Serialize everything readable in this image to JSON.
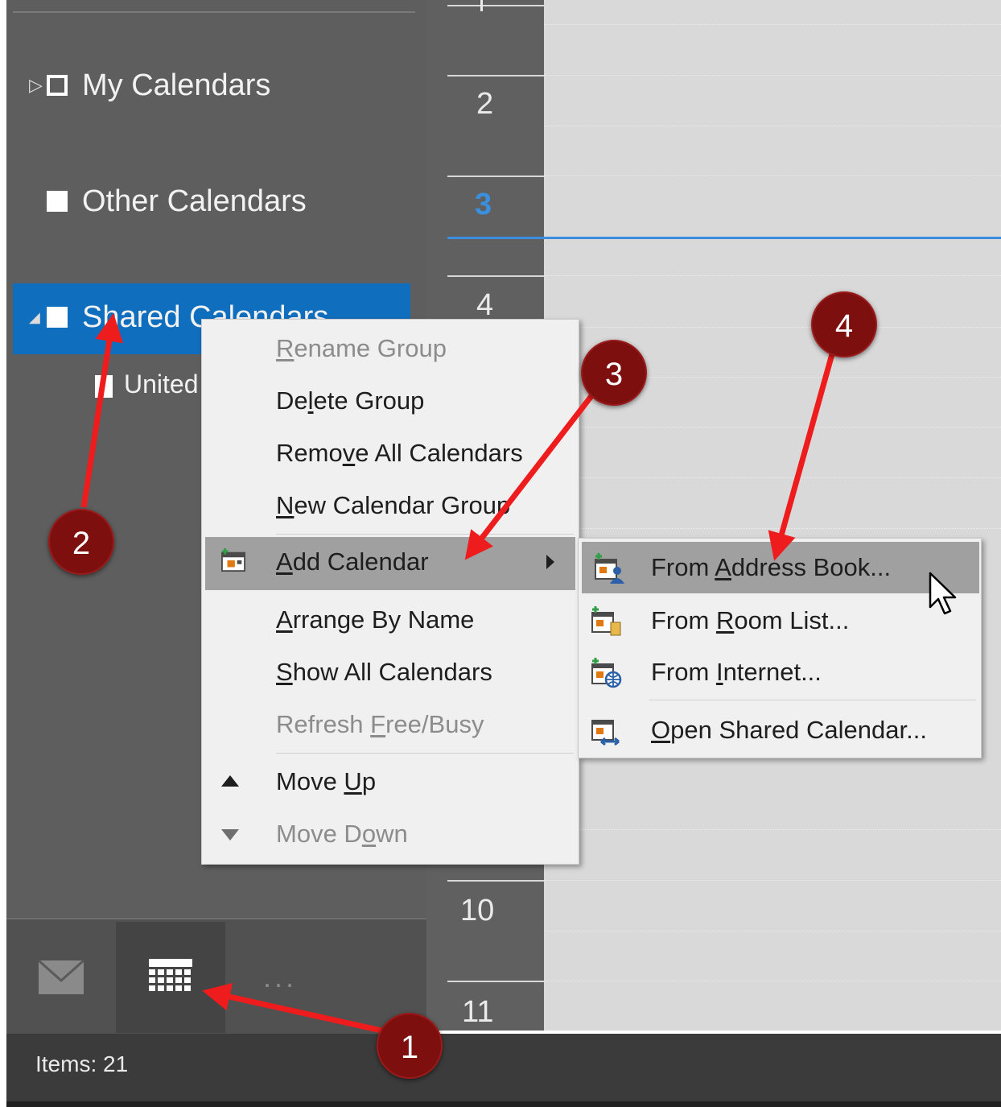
{
  "sidebar": {
    "groups": [
      {
        "label": "My Calendars"
      },
      {
        "label": "Other Calendars"
      },
      {
        "label": "Shared Calendars"
      }
    ],
    "sub_item": "United"
  },
  "time_labels": [
    "2",
    "3",
    "4",
    "10",
    "11"
  ],
  "current_hour": "3",
  "colors": {
    "accent": "#0f6ebd",
    "now_line": "#3a8fde",
    "callout": "#7d0f0f",
    "arrow": "#ee1c1c"
  },
  "context_menu": {
    "items": [
      {
        "label_pre": "",
        "key": "R",
        "label_post": "ename Group",
        "disabled": true
      },
      {
        "label_pre": "De",
        "key": "l",
        "label_post": "ete Group",
        "disabled": false
      },
      {
        "label_pre": "Remo",
        "key": "v",
        "label_post": "e All Calendars",
        "disabled": false
      },
      {
        "label_pre": "",
        "key": "N",
        "label_post": "ew Calendar Group",
        "disabled": false
      },
      {
        "label_pre": "",
        "key": "A",
        "label_post": "dd Calendar",
        "disabled": false,
        "highlighted": true,
        "icon": "add-calendar-icon",
        "has_submenu": true
      },
      {
        "label_pre": "",
        "key": "A",
        "label_post": "rrange By Name",
        "disabled": false
      },
      {
        "label_pre": "",
        "key": "S",
        "label_post": "how All Calendars",
        "disabled": false
      },
      {
        "label_pre": "Refresh ",
        "key": "F",
        "label_post": "ree/Busy",
        "disabled": true
      },
      {
        "label_pre": "Move ",
        "key": "U",
        "label_post": "p",
        "disabled": false,
        "icon": "triangle-up-icon"
      },
      {
        "label_pre": "Move D",
        "key": "o",
        "label_post": "wn",
        "disabled": true,
        "icon": "triangle-down-icon"
      }
    ]
  },
  "submenu": {
    "items": [
      {
        "label_pre": "From ",
        "key": "A",
        "label_post": "ddress Book...",
        "icon": "address-book-icon",
        "highlighted": true
      },
      {
        "label_pre": "From ",
        "key": "R",
        "label_post": "oom List...",
        "icon": "room-list-icon"
      },
      {
        "label_pre": "From ",
        "key": "I",
        "label_post": "nternet...",
        "icon": "internet-icon"
      },
      {
        "label_pre": "",
        "key": "O",
        "label_post": "pen Shared Calendar...",
        "icon": "shared-calendar-icon"
      }
    ]
  },
  "nav": {
    "more_label": "..."
  },
  "status": {
    "items": "Items: 21"
  },
  "callouts": [
    "1",
    "2",
    "3",
    "4"
  ]
}
